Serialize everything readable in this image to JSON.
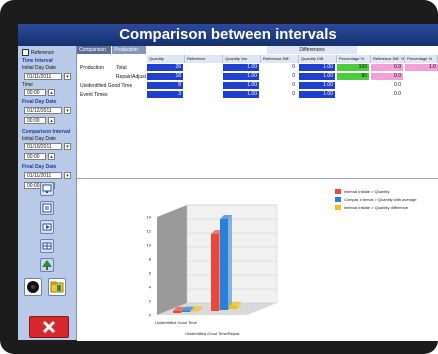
{
  "window": {
    "title": "Comparison between intervals"
  },
  "sidebar": {
    "checkbox_label": "Reference",
    "sections": [
      {
        "head": "Time Interval",
        "fields": [
          {
            "label": "Initial Day Date",
            "value": "01/11/2011"
          },
          {
            "label": "Time",
            "value": "00:00"
          }
        ]
      },
      {
        "head": "Final Day Date",
        "fields": [
          {
            "label": "",
            "value": "01/12/2011"
          },
          {
            "label": "",
            "value": "00:00"
          }
        ]
      },
      {
        "head": "Comparison Interval",
        "fields": [
          {
            "label": "Initial Day Date",
            "value": "01/10/2011"
          },
          {
            "label": "",
            "value": "00:00"
          }
        ]
      },
      {
        "head": "Final Day Date",
        "fields": [
          {
            "label": "",
            "value": "01/11/2011"
          },
          {
            "label": "",
            "value": "00:00"
          }
        ]
      }
    ]
  },
  "grid": {
    "top_tabs": [
      "Comparison",
      "Production"
    ],
    "group_header": "Differences",
    "columns": [
      "Quantity",
      "Reference",
      "Quantity Var.",
      "Reference Diff.",
      "Quantity Diff.",
      "Percentage %",
      "Reference Diff. %",
      "Percentage %"
    ],
    "rows": [
      {
        "label": "Production",
        "sub": "Total",
        "cells": [
          "26",
          "",
          "1.00",
          "0",
          "1.00",
          "100",
          "0.0",
          "1.0"
        ]
      },
      {
        "label": "",
        "sub": "Repair/Adjust",
        "cells": [
          "18",
          "",
          "1.00",
          "0",
          "1.00",
          "80",
          "0.0",
          ""
        ]
      },
      {
        "label": "Unidentified Good Time",
        "sub": "",
        "cells": [
          "8",
          "",
          "1.00",
          "0",
          "1.00",
          "",
          "0.0",
          ""
        ]
      },
      {
        "label": "Event Times",
        "sub": "",
        "cells": [
          "3",
          "",
          "1.00",
          "0",
          "1.00",
          "",
          "0.0",
          ""
        ]
      }
    ]
  },
  "chart": {
    "legend": [
      {
        "label": "Interval Initiate > Quantity",
        "color": "#e8473c"
      },
      {
        "label": "Compar. Interval > Quantity with average",
        "color": "#2a7fd6"
      },
      {
        "label": "Interval Initiate > Quantity difference",
        "color": "#f2c218"
      }
    ],
    "axis_labels": [
      "Unidentified Good Time",
      "Unidentified Good Time/Repair"
    ],
    "y_ticks": [
      "14",
      "12",
      "10",
      "8",
      "6",
      "4",
      "2",
      "0"
    ]
  },
  "chart_data": {
    "type": "bar",
    "categories": [
      "Unidentified Good Time",
      "Unidentified Good Time/Repair"
    ],
    "series": [
      {
        "name": "Interval Initiate > Quantity",
        "values": [
          0.3,
          11
        ]
      },
      {
        "name": "Compar. Interval > Quantity with average",
        "values": [
          0.2,
          13
        ]
      },
      {
        "name": "Interval Initiate > Quantity difference",
        "values": [
          0.1,
          0.5
        ]
      }
    ],
    "ylim": [
      0,
      14
    ]
  },
  "colors": {
    "accent": "#1f3fcf",
    "titlebar": "#16306e",
    "exit": "#d6282e"
  },
  "icons": [
    "monitor-icon",
    "print-icon",
    "export-icon",
    "table-icon",
    "tree-icon",
    "help-icon",
    "folder-icon",
    "close-icon"
  ]
}
